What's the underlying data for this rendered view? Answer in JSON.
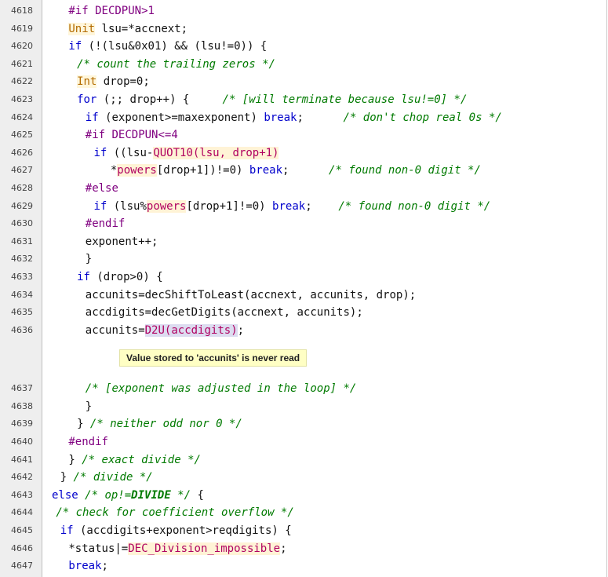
{
  "lines": [
    {
      "n": "4618",
      "indent": 16,
      "parts": [
        {
          "t": "#if DECDPUN>1",
          "c": "pp"
        }
      ]
    },
    {
      "n": "4619",
      "indent": 16,
      "parts": [
        {
          "t": "Unit",
          "c": "ty"
        },
        {
          "t": " lsu=*accnext;",
          "c": ""
        }
      ]
    },
    {
      "n": "4620",
      "indent": 16,
      "parts": [
        {
          "t": "if",
          "c": "kw"
        },
        {
          "t": " (!(lsu&0x01) && (lsu!=0)) {",
          "c": ""
        }
      ]
    },
    {
      "n": "4621",
      "indent": 18,
      "parts": [
        {
          "t": "/* count the trailing zeros */",
          "c": "cm"
        }
      ]
    },
    {
      "n": "4622",
      "indent": 18,
      "parts": [
        {
          "t": "Int",
          "c": "ty"
        },
        {
          "t": " drop=0;",
          "c": ""
        }
      ]
    },
    {
      "n": "4623",
      "indent": 18,
      "parts": [
        {
          "t": "for",
          "c": "kw"
        },
        {
          "t": " (;; drop++) {     ",
          "c": ""
        },
        {
          "t": "/* [will terminate because lsu!=0] */",
          "c": "cm"
        }
      ]
    },
    {
      "n": "4624",
      "indent": 20,
      "parts": [
        {
          "t": "if",
          "c": "kw"
        },
        {
          "t": " (exponent>=maxexponent) ",
          "c": ""
        },
        {
          "t": "break",
          "c": "kw"
        },
        {
          "t": ";      ",
          "c": ""
        },
        {
          "t": "/* don't chop real 0s */",
          "c": "cm"
        }
      ]
    },
    {
      "n": "4625",
      "indent": 20,
      "parts": [
        {
          "t": "#if DECDPUN<=4",
          "c": "pp"
        }
      ]
    },
    {
      "n": "4626",
      "indent": 22,
      "parts": [
        {
          "t": "if",
          "c": "kw"
        },
        {
          "t": " ((lsu-",
          "c": ""
        },
        {
          "t": "QUOT10(lsu, drop+1)",
          "c": "mac"
        }
      ]
    },
    {
      "n": "4627",
      "indent": 26,
      "parts": [
        {
          "t": "*",
          "c": ""
        },
        {
          "t": "powers",
          "c": "mac"
        },
        {
          "t": "[drop+1])!=0) ",
          "c": ""
        },
        {
          "t": "break",
          "c": "kw"
        },
        {
          "t": ";      ",
          "c": ""
        },
        {
          "t": "/* found non-0 digit */",
          "c": "cm"
        }
      ]
    },
    {
      "n": "4628",
      "indent": 20,
      "parts": [
        {
          "t": "#else",
          "c": "pp"
        }
      ]
    },
    {
      "n": "4629",
      "indent": 22,
      "parts": [
        {
          "t": "if",
          "c": "kw"
        },
        {
          "t": " (lsu%",
          "c": ""
        },
        {
          "t": "powers",
          "c": "mac"
        },
        {
          "t": "[drop+1]!=0) ",
          "c": ""
        },
        {
          "t": "break",
          "c": "kw"
        },
        {
          "t": ";    ",
          "c": ""
        },
        {
          "t": "/* found non-0 digit */",
          "c": "cm"
        }
      ]
    },
    {
      "n": "4630",
      "indent": 20,
      "parts": [
        {
          "t": "#endif",
          "c": "pp"
        }
      ]
    },
    {
      "n": "4631",
      "indent": 20,
      "parts": [
        {
          "t": "exponent++;",
          "c": ""
        }
      ]
    },
    {
      "n": "4632",
      "indent": 20,
      "parts": [
        {
          "t": "}",
          "c": ""
        }
      ]
    },
    {
      "n": "4633",
      "indent": 18,
      "parts": [
        {
          "t": "if",
          "c": "kw"
        },
        {
          "t": " (drop>0) {",
          "c": ""
        }
      ]
    },
    {
      "n": "4634",
      "indent": 20,
      "parts": [
        {
          "t": "accunits=decShiftToLeast(accnext, accunits, drop);",
          "c": ""
        }
      ]
    },
    {
      "n": "4635",
      "indent": 20,
      "parts": [
        {
          "t": "accdigits=decGetDigits(accnext, accunits);",
          "c": ""
        }
      ]
    },
    {
      "n": "4636",
      "indent": 20,
      "parts": [
        {
          "t": "accunits=",
          "c": ""
        },
        {
          "t": "D2U(accdigits)",
          "c": "hl"
        },
        {
          "t": ";",
          "c": ""
        }
      ]
    },
    {
      "note": "Value stored to 'accunits' is never read"
    },
    {
      "n": "4637",
      "indent": 20,
      "parts": [
        {
          "t": "/* [exponent was adjusted in the loop] */",
          "c": "cm"
        }
      ]
    },
    {
      "n": "4638",
      "indent": 20,
      "parts": [
        {
          "t": "}",
          "c": ""
        }
      ]
    },
    {
      "n": "4639",
      "indent": 18,
      "parts": [
        {
          "t": "} ",
          "c": ""
        },
        {
          "t": "/* neither odd nor 0 */",
          "c": "cm"
        }
      ]
    },
    {
      "n": "4640",
      "indent": 16,
      "parts": [
        {
          "t": "#endif",
          "c": "pp"
        }
      ]
    },
    {
      "n": "4641",
      "indent": 16,
      "parts": [
        {
          "t": "} ",
          "c": ""
        },
        {
          "t": "/* exact divide */",
          "c": "cm"
        }
      ]
    },
    {
      "n": "4642",
      "indent": 14,
      "parts": [
        {
          "t": "} ",
          "c": ""
        },
        {
          "t": "/* divide */",
          "c": "cm"
        }
      ]
    },
    {
      "n": "4643",
      "indent": 12,
      "parts": [
        {
          "t": "else",
          "c": "kw"
        },
        {
          "t": " ",
          "c": ""
        },
        {
          "t": "/* op!=",
          "c": "cm"
        },
        {
          "t": "DIVIDE",
          "c": "cm bd"
        },
        {
          "t": " */",
          "c": "cm"
        },
        {
          "t": " {",
          "c": ""
        }
      ]
    },
    {
      "n": "4644",
      "indent": 13,
      "parts": [
        {
          "t": "/* check for coefficient overflow */",
          "c": "cm"
        }
      ]
    },
    {
      "n": "4645",
      "indent": 14,
      "parts": [
        {
          "t": "if",
          "c": "kw"
        },
        {
          "t": " (accdigits+exponent>reqdigits) {",
          "c": ""
        }
      ]
    },
    {
      "n": "4646",
      "indent": 16,
      "parts": [
        {
          "t": "*status|=",
          "c": ""
        },
        {
          "t": "DEC_Division_impossible",
          "c": "mac"
        },
        {
          "t": ";",
          "c": ""
        }
      ]
    },
    {
      "n": "4647",
      "indent": 16,
      "parts": [
        {
          "t": "break",
          "c": "kw"
        },
        {
          "t": ";",
          "c": ""
        }
      ]
    }
  ]
}
